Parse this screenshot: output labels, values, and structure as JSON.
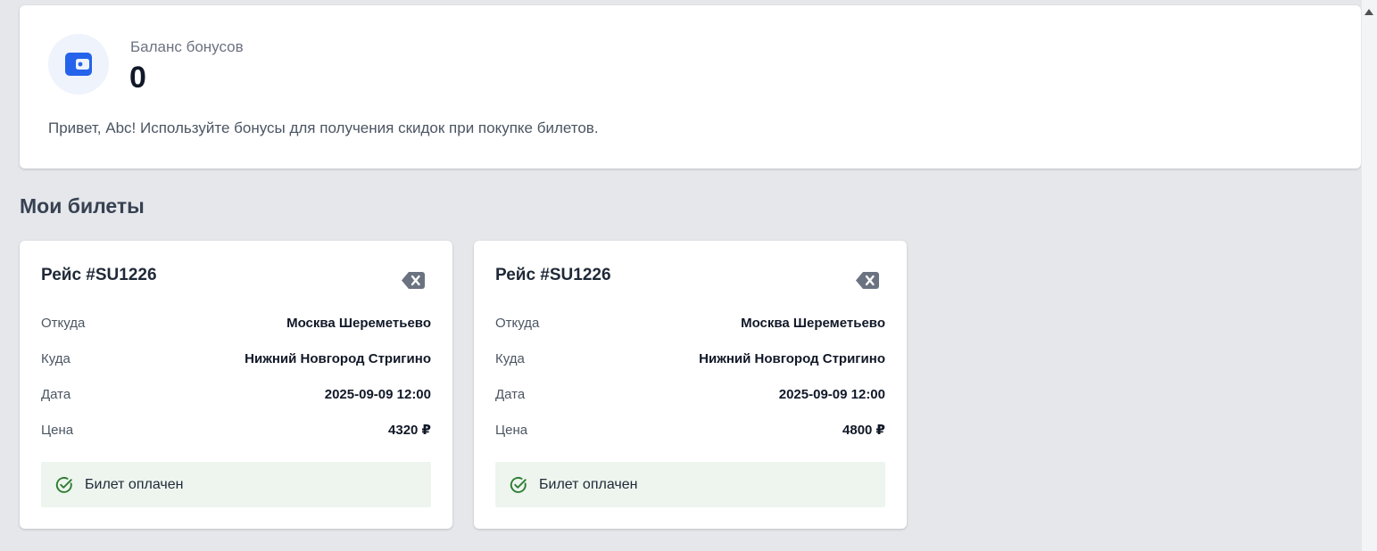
{
  "balance": {
    "icon": "wallet-icon",
    "label": "Баланс бонусов",
    "value": "0",
    "description": "Привет, Abc! Используйте бонусы для получения скидок при покупке билетов."
  },
  "tickets_section": {
    "title": "Мои билеты"
  },
  "tickets": [
    {
      "flight": "Рейс #SU1226",
      "from_label": "Откуда",
      "from_value": "Москва Шереметьево",
      "to_label": "Куда",
      "to_value": "Нижний Новгород Стригино",
      "date_label": "Дата",
      "date_value": "2025-09-09 12:00",
      "price_label": "Цена",
      "price_value": "4320 ₽",
      "status": "Билет оплачен",
      "delete_icon": "backspace-delete-icon",
      "status_icon": "check-circle-icon"
    },
    {
      "flight": "Рейс #SU1226",
      "from_label": "Откуда",
      "from_value": "Москва Шереметьево",
      "to_label": "Куда",
      "to_value": "Нижний Новгород Стригино",
      "date_label": "Дата",
      "date_value": "2025-09-09 12:00",
      "price_label": "Цена",
      "price_value": "4800 ₽",
      "status": "Билет оплачен",
      "delete_icon": "backspace-delete-icon",
      "status_icon": "check-circle-icon"
    }
  ],
  "colors": {
    "accent": "#2563eb",
    "success": "#2e7d32",
    "success_bg": "#edf5ee",
    "page_bg": "#e5e7eb"
  }
}
